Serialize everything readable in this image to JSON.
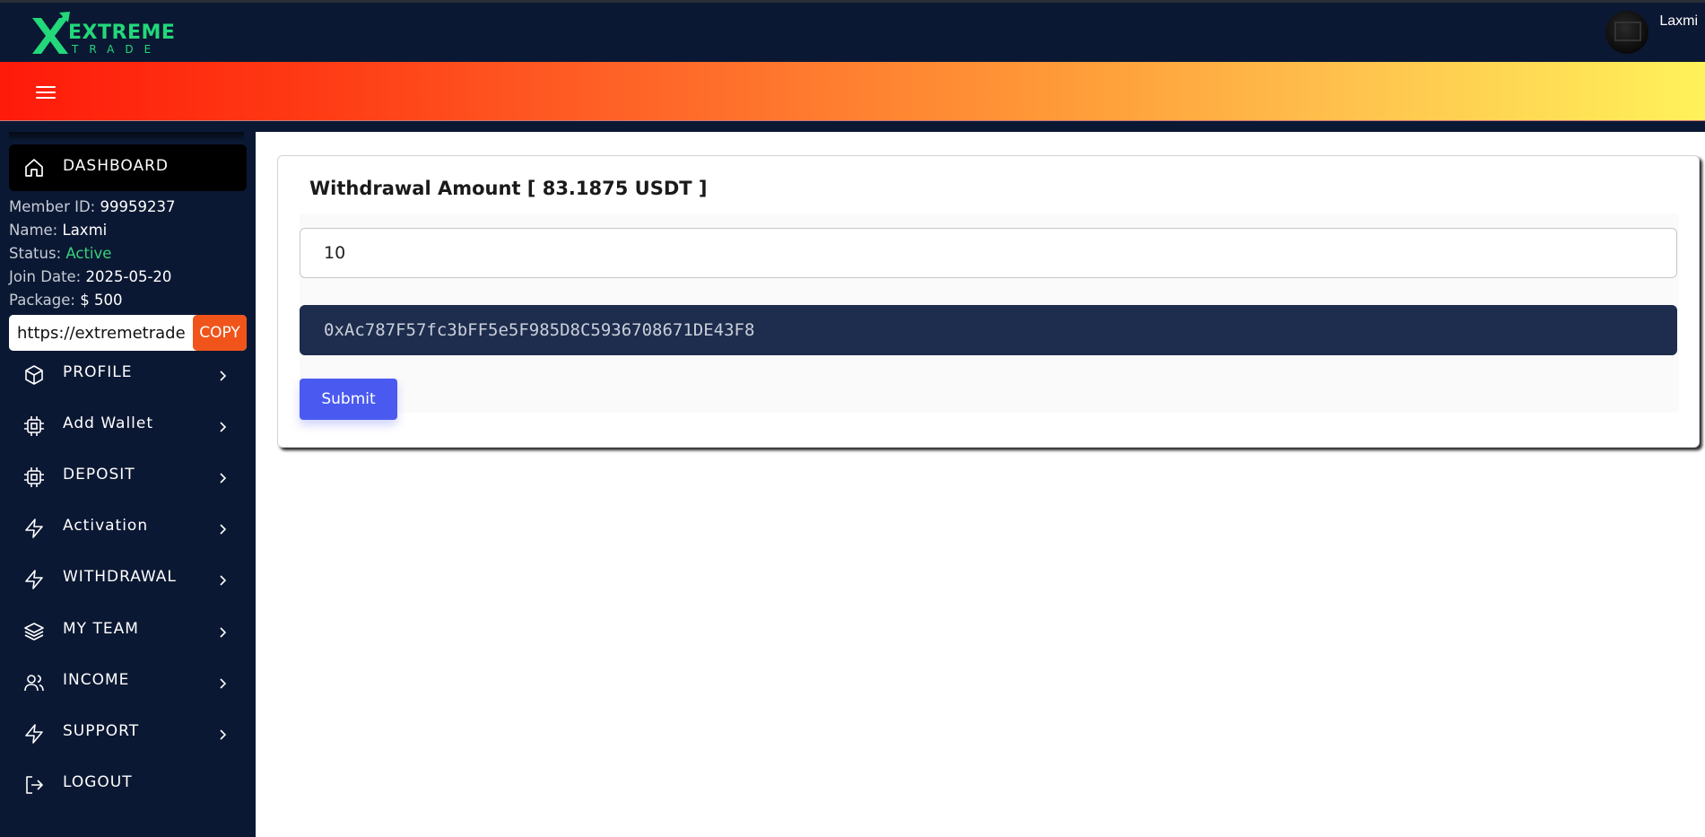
{
  "brand": {
    "name_top": "EXTREME",
    "name_bottom": "TRADE"
  },
  "header": {
    "user_name": "Laxmi"
  },
  "sidebar": {
    "dashboard_label": "DASHBOARD",
    "member_info": {
      "member_id_label": "Member ID:",
      "member_id": "99959237",
      "name_label": "Name:",
      "name": "Laxmi",
      "status_label": "Status:",
      "status": "Active",
      "join_date_label": "Join Date:",
      "join_date": "2025-05-20",
      "package_label": "Package:",
      "package": "$ 500"
    },
    "referral": {
      "value": "https://extremetrade",
      "copy_label": "COPY"
    },
    "items": [
      {
        "label": "PROFILE",
        "icon": "cube-icon"
      },
      {
        "label": "Add Wallet",
        "icon": "cpu-chip-icon"
      },
      {
        "label": "DEPOSIT",
        "icon": "cpu-chip-icon"
      },
      {
        "label": "Activation",
        "icon": "lightning-icon"
      },
      {
        "label": "WITHDRAWAL",
        "icon": "lightning-icon"
      },
      {
        "label": "MY TEAM",
        "icon": "layers-icon"
      },
      {
        "label": "INCOME",
        "icon": "users-icon"
      },
      {
        "label": "SUPPORT",
        "icon": "lightning-icon"
      }
    ],
    "logout_label": "LOGOUT"
  },
  "withdrawal": {
    "title": "Withdrawal Amount [ 83.1875 USDT ]",
    "amount_value": "10",
    "wallet_address": "0xAc787F57fc3bFF5e5F985D8C5936708671DE43F8",
    "submit_label": "Submit"
  },
  "colors": {
    "nav_bg": "#0b1833",
    "accent_orange": "#f0541b",
    "status_active": "#36d27a",
    "submit_blue": "#4a5af0",
    "wallet_field_bg": "#1e2d4d"
  }
}
